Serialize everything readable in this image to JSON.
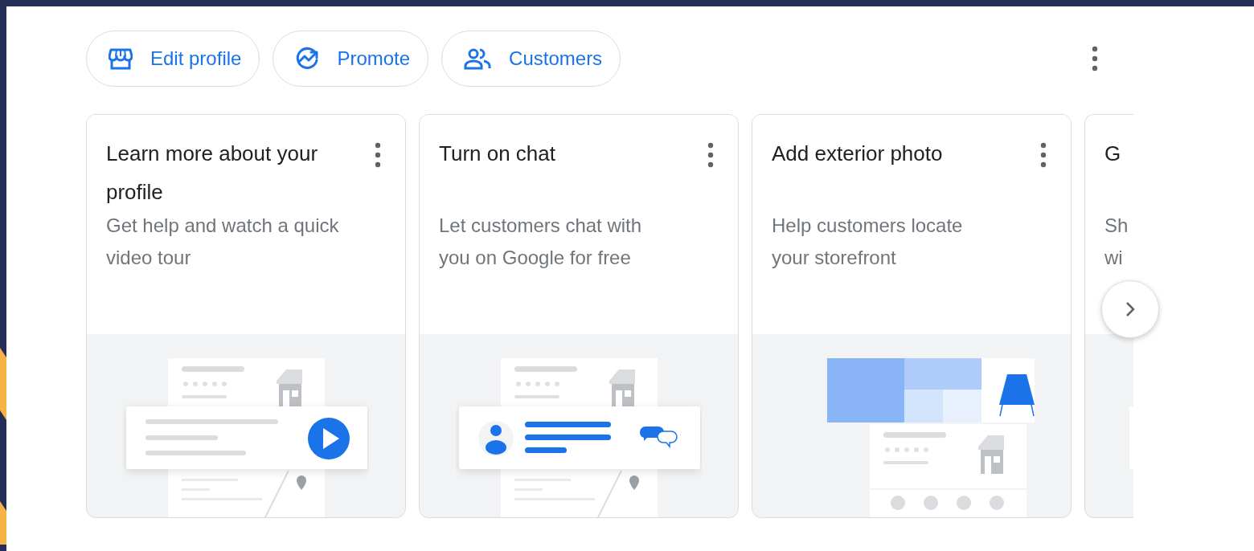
{
  "actions": [
    {
      "label": "Edit profile"
    },
    {
      "label": "Promote"
    },
    {
      "label": "Customers"
    }
  ],
  "cards": [
    {
      "kind": "video",
      "title": "Learn more about your profile",
      "description_lines": [
        "Get help and watch a quick",
        "video tour"
      ]
    },
    {
      "kind": "chat",
      "title": "Turn on chat",
      "description_lines": [
        "Let customers chat with",
        "you on Google for free"
      ]
    },
    {
      "kind": "photo",
      "title": "Add exterior photo",
      "description_lines": [
        "Help customers locate",
        "your storefront"
      ]
    },
    {
      "kind": "partial",
      "title": "G",
      "description_lines": [
        "Sh",
        "wi"
      ]
    }
  ]
}
